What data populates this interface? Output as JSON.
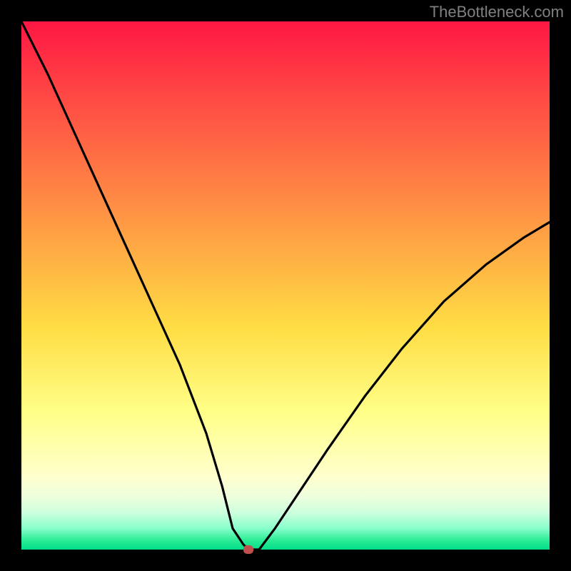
{
  "watermark": "TheBottleneck.com",
  "chart_data": {
    "type": "line",
    "title": "",
    "xlabel": "",
    "ylabel": "",
    "xlim": [
      0,
      100
    ],
    "ylim": [
      0,
      100
    ],
    "grid": false,
    "background_gradient": {
      "orientation": "vertical",
      "stops": [
        {
          "pos": 0.0,
          "color": "#ff1744"
        },
        {
          "pos": 0.5,
          "color": "#ffdd44"
        },
        {
          "pos": 0.85,
          "color": "#ffffcc"
        },
        {
          "pos": 1.0,
          "color": "#00dd88"
        }
      ]
    },
    "series": [
      {
        "name": "bottleneck-curve",
        "color": "#000000",
        "x": [
          0,
          5,
          10,
          15,
          20,
          25,
          30,
          35,
          38,
          40,
          42,
          43,
          45,
          48,
          52,
          58,
          65,
          72,
          80,
          88,
          95,
          100
        ],
        "y": [
          100,
          90,
          79,
          68,
          57,
          46,
          35,
          22,
          12,
          4,
          1,
          0,
          0,
          4,
          10,
          19,
          29,
          38,
          47,
          54,
          59,
          62
        ]
      }
    ],
    "annotations": [
      {
        "name": "minimum-marker",
        "type": "point",
        "x": 43,
        "y": 0,
        "color": "#c0504d"
      }
    ]
  }
}
